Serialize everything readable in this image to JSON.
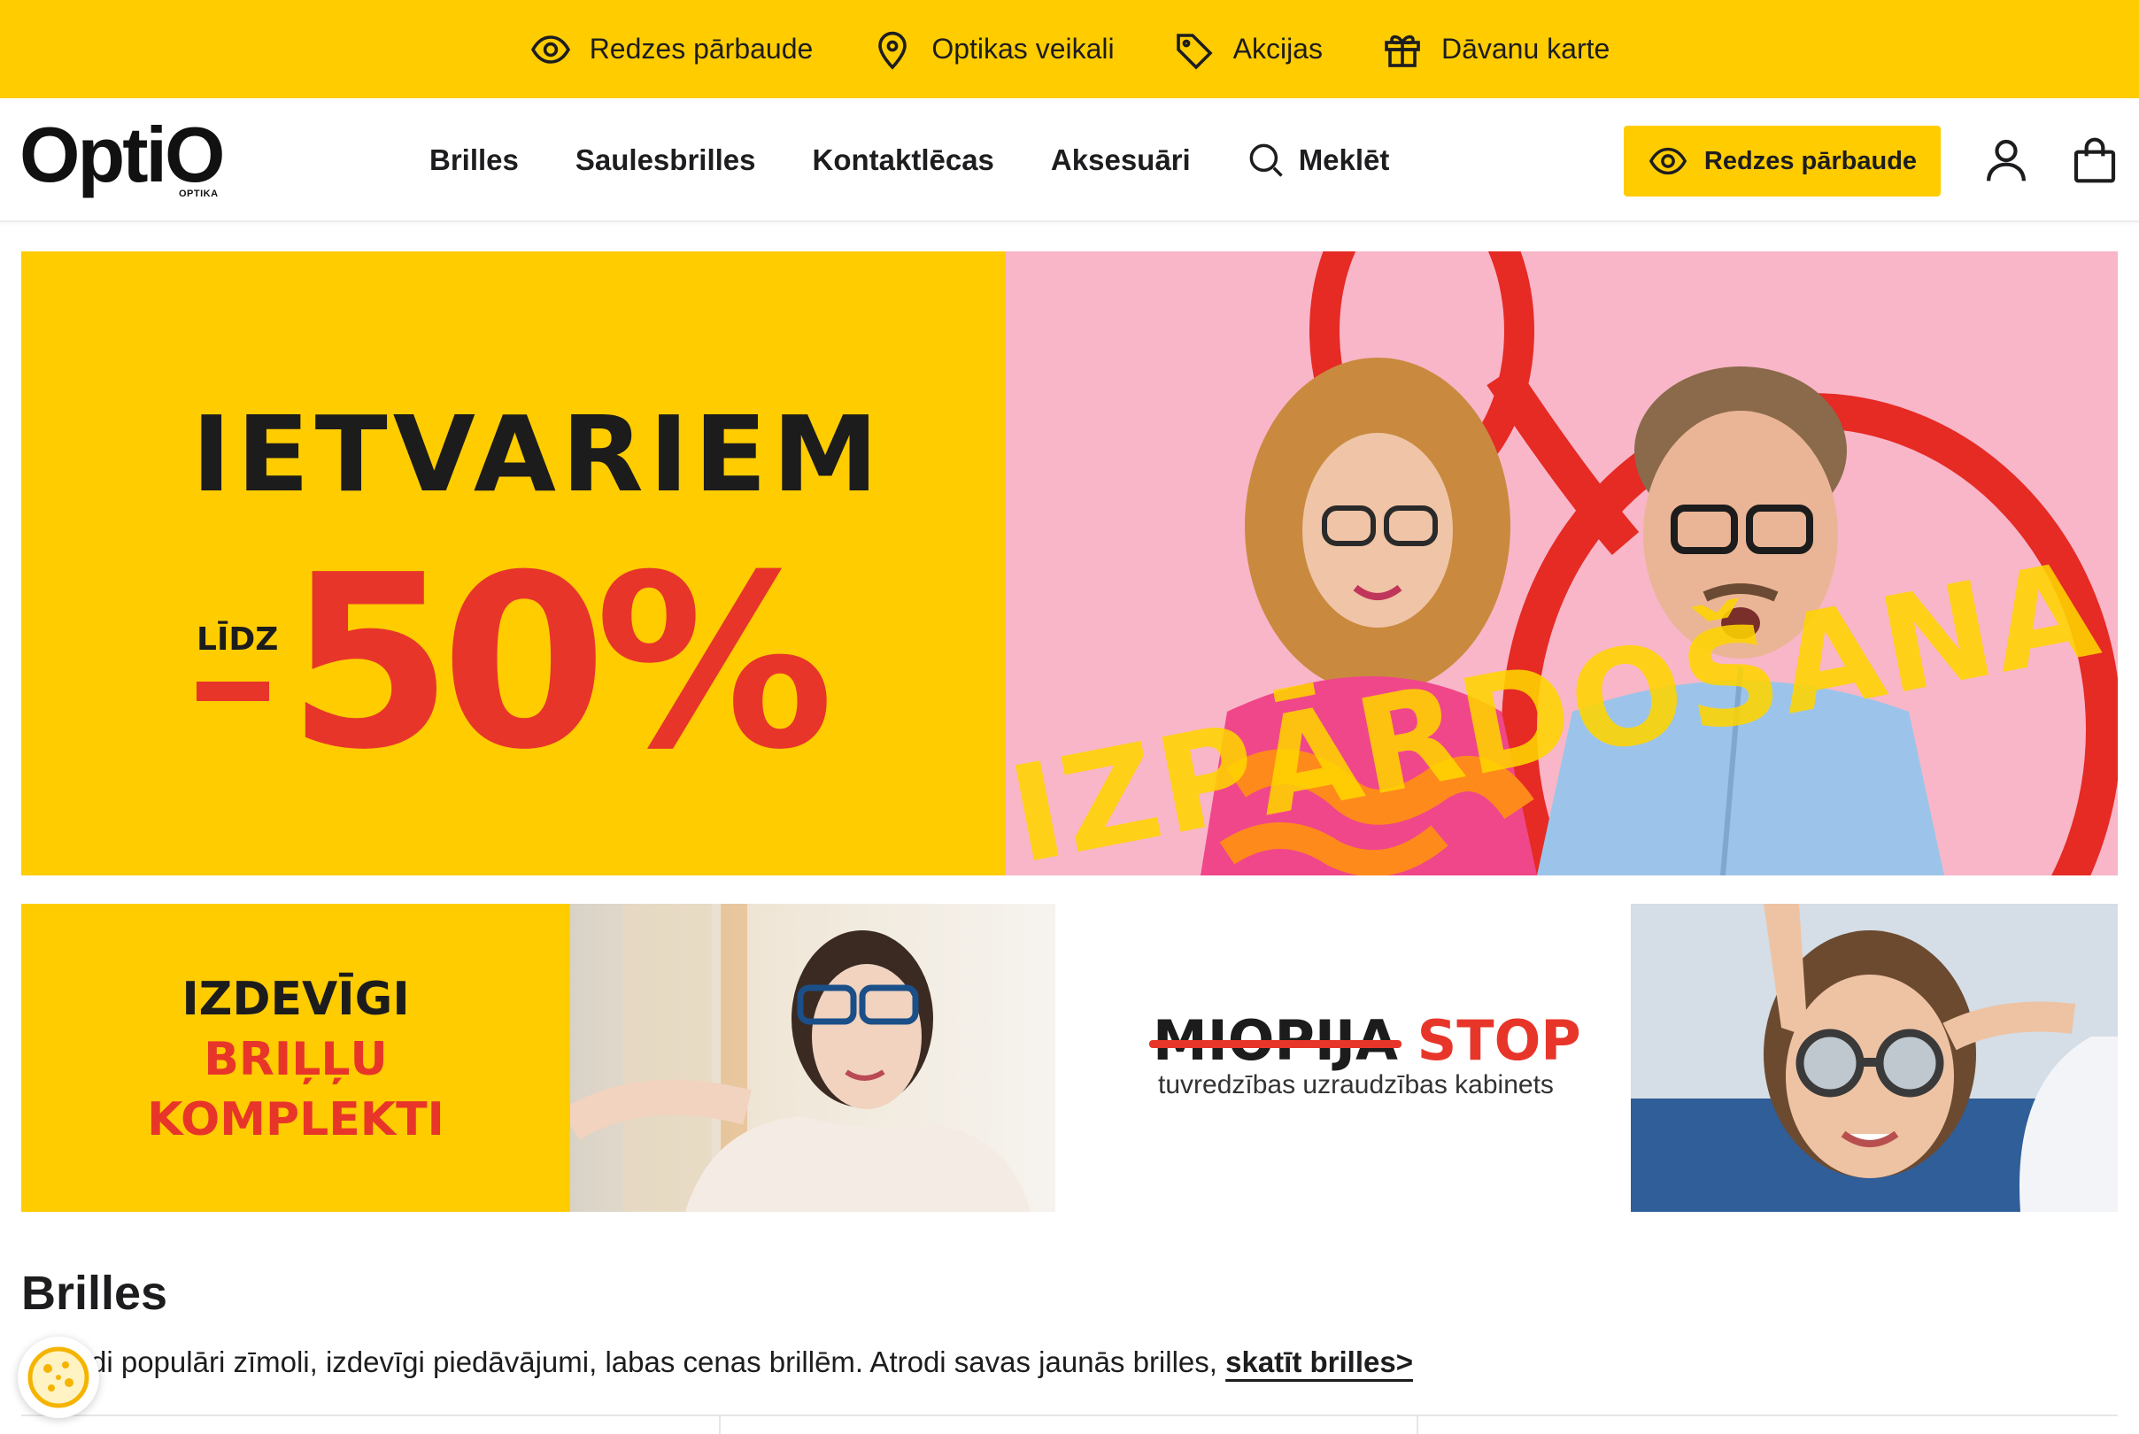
{
  "topbar": {
    "items": [
      {
        "label": "Redzes pārbaude",
        "icon": "eye-icon"
      },
      {
        "label": "Optikas veikali",
        "icon": "map-pin-icon"
      },
      {
        "label": "Akcijas",
        "icon": "tag-icon"
      },
      {
        "label": "Dāvanu karte",
        "icon": "gift-icon"
      }
    ]
  },
  "header": {
    "logo_text": "OptiO",
    "logo_sub": "OPTIKA",
    "nav": [
      "Brilles",
      "Saulesbrilles",
      "Kontaktlēcas",
      "Aksesuāri"
    ],
    "search_label": "Meklēt",
    "cta_label": "Redzes pārbaude",
    "account_icon": "user-icon",
    "cart_icon": "shopping-bag-icon"
  },
  "hero": {
    "title": "IETVARIEM",
    "prefix": "LĪDZ",
    "discount": "50%",
    "overlay_word": "IZPĀRDOŠANA"
  },
  "banners": {
    "kits": {
      "line1": "IZDEVĪGI",
      "line2": "BRIĻĻU",
      "line3": "KOMPLEKTI"
    },
    "myopia": {
      "word": "MIOPIJA",
      "stop": "STOP",
      "subtitle": "tuvredzības uzraudzības kabinets"
    }
  },
  "section": {
    "title": "Brilles",
    "text": "Zīmoli populāri zīmoli, izdevīgi piedāvājumi, labas cenas brillēm. Atrodi savas jaunās brilles,",
    "text_visible": "di populāri zīmoli, izdevīgi piedāvājumi, labas cenas brillēm. Atrodi savas jaunās brilles, ",
    "link": "skatīt brilles>"
  },
  "colors": {
    "brand_yellow": "#ffcc00",
    "accent_red": "#e8352a",
    "text": "#1d1d1f"
  }
}
